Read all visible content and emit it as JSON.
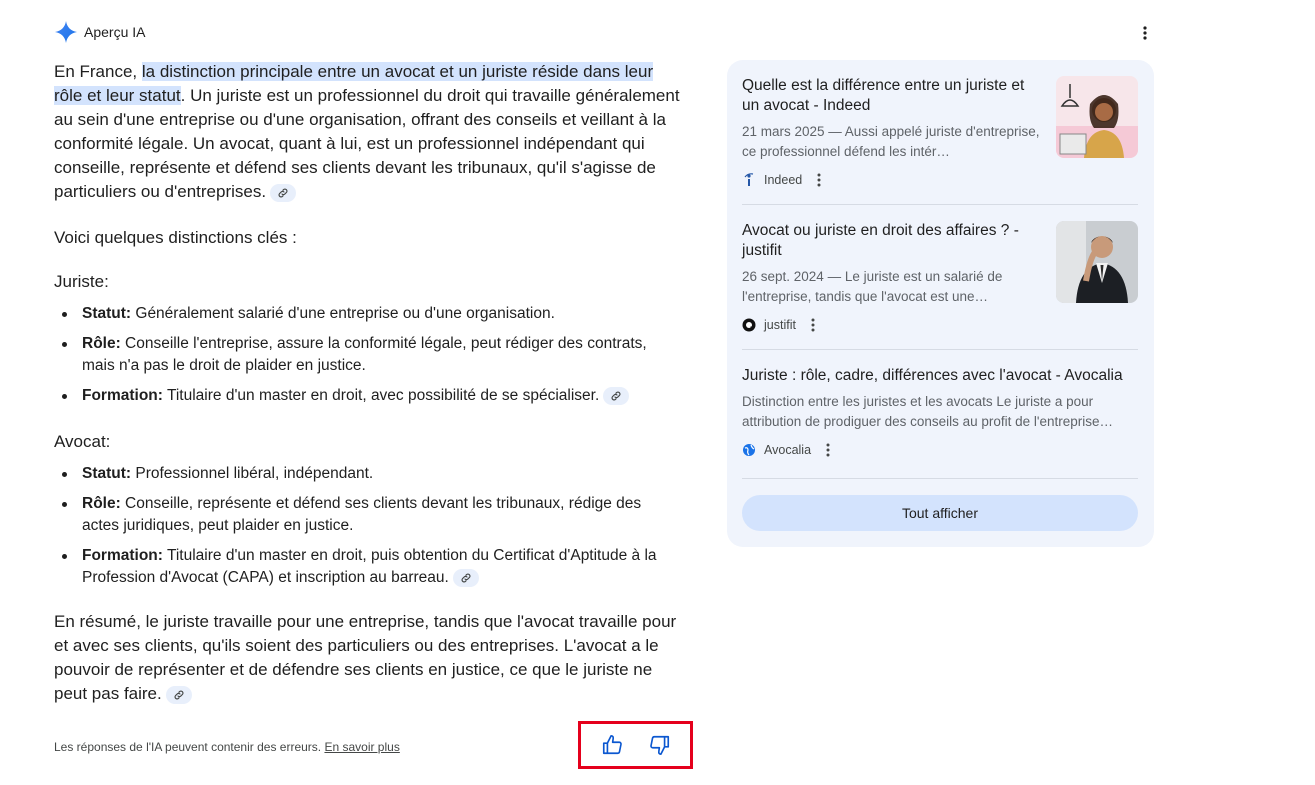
{
  "header": {
    "title": "Aperçu IA",
    "icon": "gemini-spark-icon"
  },
  "answer": {
    "para1_prefix": "En France, ",
    "para1_highlight": "la distinction principale entre un avocat et un juriste réside dans leur rôle et leur statut",
    "para1_rest": ". Un juriste est un professionnel du droit qui travaille généralement au sein d'une entreprise ou d'une organisation, offrant des conseils et veillant à la conformité légale. Un avocat, quant à lui, est un professionnel indépendant qui conseille, représente et défend ses clients devant les tribunaux, qu'il s'agisse de particuliers ou d'entreprises.",
    "intro": "Voici quelques distinctions clés :",
    "juriste_heading": "Juriste:",
    "juriste_items": [
      {
        "label": "Statut:",
        "text": " Généralement salarié d'une entreprise ou d'une organisation."
      },
      {
        "label": "Rôle:",
        "text": " Conseille l'entreprise, assure la conformité légale, peut rédiger des contrats, mais n'a pas le droit de plaider en justice."
      },
      {
        "label": "Formation:",
        "text": " Titulaire d'un master en droit, avec possibilité de se spécialiser."
      }
    ],
    "avocat_heading": "Avocat:",
    "avocat_items": [
      {
        "label": "Statut:",
        "text": " Professionnel libéral, indépendant."
      },
      {
        "label": "Rôle:",
        "text": " Conseille, représente et défend ses clients devant les tribunaux, rédige des actes juridiques, peut plaider en justice."
      },
      {
        "label": "Formation:",
        "text": " Titulaire d'un master en droit, puis obtention du Certificat d'Aptitude à la Profession d'Avocat (CAPA) et inscription au barreau."
      }
    ],
    "summary": "En résumé, le juriste travaille pour une entreprise, tandis que l'avocat travaille pour et avec ses clients, qu'ils soient des particuliers ou des entreprises. L'avocat a le pouvoir de représenter et de défendre ses clients en justice, ce que le juriste ne peut pas faire."
  },
  "footer": {
    "disclaimer": "Les réponses de l'IA peuvent contenir des erreurs. ",
    "learn_more": "En savoir plus"
  },
  "sources": [
    {
      "title": "Quelle est la différence entre un juriste et un avocat - Indeed",
      "snippet": "21 mars 2025 — Aussi appelé juriste d'entreprise, ce professionnel défend les intér…",
      "site": "Indeed"
    },
    {
      "title": "Avocat ou juriste en droit des affaires ? - justifit",
      "snippet": "26 sept. 2024 — Le juriste est un salarié de l'entreprise, tandis que l'avocat est une…",
      "site": "justifit"
    },
    {
      "title": "Juriste : rôle, cadre, différences avec l'avocat - Avocalia",
      "snippet": "Distinction entre les juristes et les avocats Le juriste a pour attribution de prodiguer des conseils au profit de l'entreprise…",
      "site": "Avocalia"
    }
  ],
  "show_all": "Tout afficher",
  "colors": {
    "highlight": "#d3e3fd",
    "panel_bg": "#f0f4fc",
    "feedback_border": "#e5001c",
    "accent": "#0b57d0"
  }
}
